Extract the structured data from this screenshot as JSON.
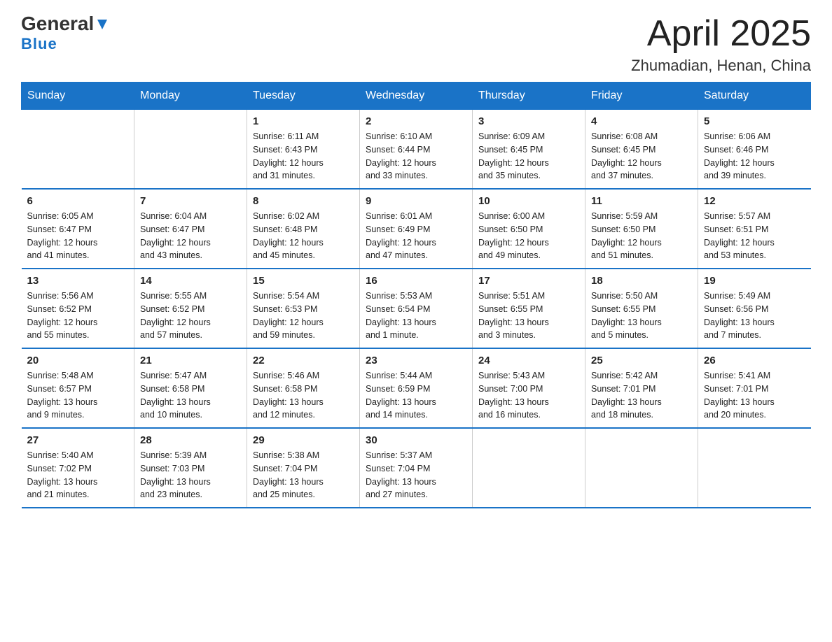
{
  "header": {
    "logo_general": "General",
    "logo_blue": "Blue",
    "month_title": "April 2025",
    "location": "Zhumadian, Henan, China"
  },
  "days_of_week": [
    "Sunday",
    "Monday",
    "Tuesday",
    "Wednesday",
    "Thursday",
    "Friday",
    "Saturday"
  ],
  "weeks": [
    [
      {
        "day": "",
        "info": ""
      },
      {
        "day": "",
        "info": ""
      },
      {
        "day": "1",
        "info": "Sunrise: 6:11 AM\nSunset: 6:43 PM\nDaylight: 12 hours\nand 31 minutes."
      },
      {
        "day": "2",
        "info": "Sunrise: 6:10 AM\nSunset: 6:44 PM\nDaylight: 12 hours\nand 33 minutes."
      },
      {
        "day": "3",
        "info": "Sunrise: 6:09 AM\nSunset: 6:45 PM\nDaylight: 12 hours\nand 35 minutes."
      },
      {
        "day": "4",
        "info": "Sunrise: 6:08 AM\nSunset: 6:45 PM\nDaylight: 12 hours\nand 37 minutes."
      },
      {
        "day": "5",
        "info": "Sunrise: 6:06 AM\nSunset: 6:46 PM\nDaylight: 12 hours\nand 39 minutes."
      }
    ],
    [
      {
        "day": "6",
        "info": "Sunrise: 6:05 AM\nSunset: 6:47 PM\nDaylight: 12 hours\nand 41 minutes."
      },
      {
        "day": "7",
        "info": "Sunrise: 6:04 AM\nSunset: 6:47 PM\nDaylight: 12 hours\nand 43 minutes."
      },
      {
        "day": "8",
        "info": "Sunrise: 6:02 AM\nSunset: 6:48 PM\nDaylight: 12 hours\nand 45 minutes."
      },
      {
        "day": "9",
        "info": "Sunrise: 6:01 AM\nSunset: 6:49 PM\nDaylight: 12 hours\nand 47 minutes."
      },
      {
        "day": "10",
        "info": "Sunrise: 6:00 AM\nSunset: 6:50 PM\nDaylight: 12 hours\nand 49 minutes."
      },
      {
        "day": "11",
        "info": "Sunrise: 5:59 AM\nSunset: 6:50 PM\nDaylight: 12 hours\nand 51 minutes."
      },
      {
        "day": "12",
        "info": "Sunrise: 5:57 AM\nSunset: 6:51 PM\nDaylight: 12 hours\nand 53 minutes."
      }
    ],
    [
      {
        "day": "13",
        "info": "Sunrise: 5:56 AM\nSunset: 6:52 PM\nDaylight: 12 hours\nand 55 minutes."
      },
      {
        "day": "14",
        "info": "Sunrise: 5:55 AM\nSunset: 6:52 PM\nDaylight: 12 hours\nand 57 minutes."
      },
      {
        "day": "15",
        "info": "Sunrise: 5:54 AM\nSunset: 6:53 PM\nDaylight: 12 hours\nand 59 minutes."
      },
      {
        "day": "16",
        "info": "Sunrise: 5:53 AM\nSunset: 6:54 PM\nDaylight: 13 hours\nand 1 minute."
      },
      {
        "day": "17",
        "info": "Sunrise: 5:51 AM\nSunset: 6:55 PM\nDaylight: 13 hours\nand 3 minutes."
      },
      {
        "day": "18",
        "info": "Sunrise: 5:50 AM\nSunset: 6:55 PM\nDaylight: 13 hours\nand 5 minutes."
      },
      {
        "day": "19",
        "info": "Sunrise: 5:49 AM\nSunset: 6:56 PM\nDaylight: 13 hours\nand 7 minutes."
      }
    ],
    [
      {
        "day": "20",
        "info": "Sunrise: 5:48 AM\nSunset: 6:57 PM\nDaylight: 13 hours\nand 9 minutes."
      },
      {
        "day": "21",
        "info": "Sunrise: 5:47 AM\nSunset: 6:58 PM\nDaylight: 13 hours\nand 10 minutes."
      },
      {
        "day": "22",
        "info": "Sunrise: 5:46 AM\nSunset: 6:58 PM\nDaylight: 13 hours\nand 12 minutes."
      },
      {
        "day": "23",
        "info": "Sunrise: 5:44 AM\nSunset: 6:59 PM\nDaylight: 13 hours\nand 14 minutes."
      },
      {
        "day": "24",
        "info": "Sunrise: 5:43 AM\nSunset: 7:00 PM\nDaylight: 13 hours\nand 16 minutes."
      },
      {
        "day": "25",
        "info": "Sunrise: 5:42 AM\nSunset: 7:01 PM\nDaylight: 13 hours\nand 18 minutes."
      },
      {
        "day": "26",
        "info": "Sunrise: 5:41 AM\nSunset: 7:01 PM\nDaylight: 13 hours\nand 20 minutes."
      }
    ],
    [
      {
        "day": "27",
        "info": "Sunrise: 5:40 AM\nSunset: 7:02 PM\nDaylight: 13 hours\nand 21 minutes."
      },
      {
        "day": "28",
        "info": "Sunrise: 5:39 AM\nSunset: 7:03 PM\nDaylight: 13 hours\nand 23 minutes."
      },
      {
        "day": "29",
        "info": "Sunrise: 5:38 AM\nSunset: 7:04 PM\nDaylight: 13 hours\nand 25 minutes."
      },
      {
        "day": "30",
        "info": "Sunrise: 5:37 AM\nSunset: 7:04 PM\nDaylight: 13 hours\nand 27 minutes."
      },
      {
        "day": "",
        "info": ""
      },
      {
        "day": "",
        "info": ""
      },
      {
        "day": "",
        "info": ""
      }
    ]
  ]
}
